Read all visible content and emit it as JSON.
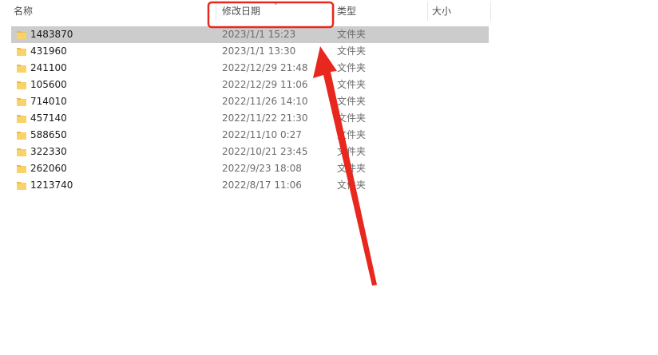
{
  "columns": {
    "name": "名称",
    "modified": "修改日期",
    "type": "类型",
    "size": "大小"
  },
  "rows": [
    {
      "name": "1483870",
      "modified": "2023/1/1 15:23",
      "type": "文件夹",
      "selected": true
    },
    {
      "name": "431960",
      "modified": "2023/1/1 13:30",
      "type": "文件夹"
    },
    {
      "name": "241100",
      "modified": "2022/12/29 21:48",
      "type": "文件夹"
    },
    {
      "name": "105600",
      "modified": "2022/12/29 11:06",
      "type": "文件夹"
    },
    {
      "name": "714010",
      "modified": "2022/11/26 14:10",
      "type": "文件夹"
    },
    {
      "name": "457140",
      "modified": "2022/11/22 21:30",
      "type": "文件夹"
    },
    {
      "name": "588650",
      "modified": "2022/11/10 0:27",
      "type": "文件夹"
    },
    {
      "name": "322330",
      "modified": "2022/10/21 23:45",
      "type": "文件夹"
    },
    {
      "name": "262060",
      "modified": "2022/9/23 18:08",
      "type": "文件夹"
    },
    {
      "name": "1213740",
      "modified": "2022/8/17 11:06",
      "type": "文件夹"
    }
  ],
  "icons": {
    "folder": "folder-icon",
    "sort": "sort-caret-icon"
  },
  "colors": {
    "selection": "#cccccc",
    "annotation": "#e8281e",
    "folder": "#f5c451"
  }
}
